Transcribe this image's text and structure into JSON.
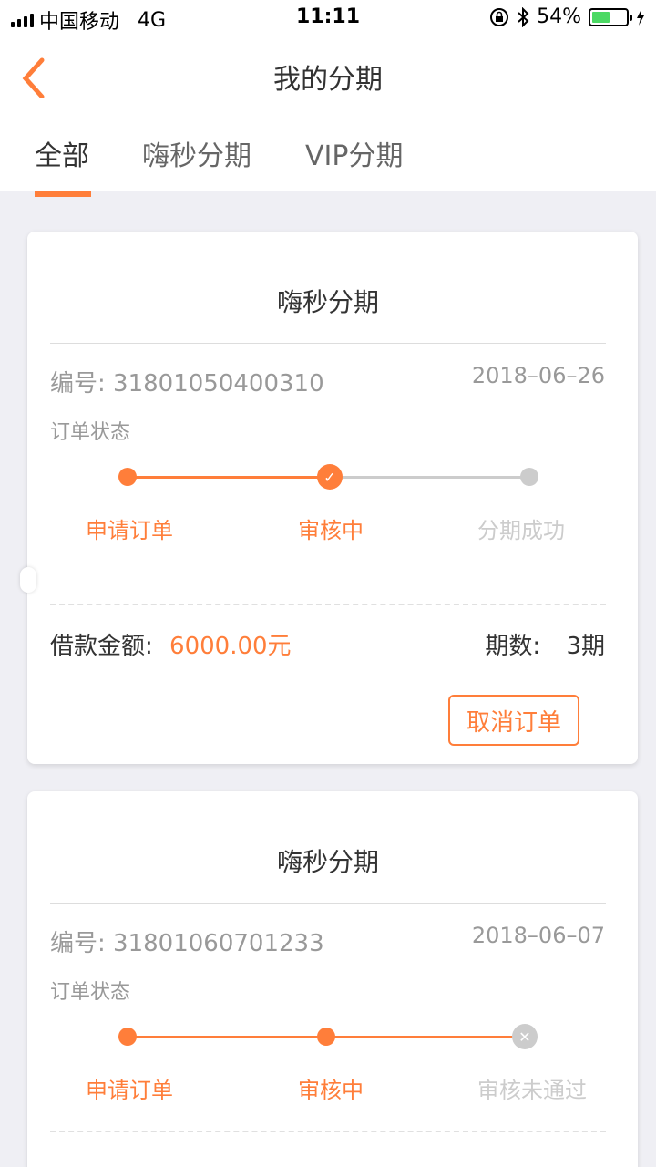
{
  "status_bar": {
    "carrier": "中国移动",
    "network": "4G",
    "time": "11:11",
    "battery_percent": "54%",
    "battery_level": 0.54
  },
  "nav": {
    "title": "我的分期",
    "back_icon": "chevron-left-icon"
  },
  "tabs": [
    {
      "label": "全部",
      "active": true
    },
    {
      "label": "嗨秒分期",
      "active": false
    },
    {
      "label": "VIP分期",
      "active": false
    }
  ],
  "colors": {
    "accent": "#ff7e3a",
    "inactive": "#cccccc",
    "background": "#efeff4"
  },
  "orders": [
    {
      "title": "嗨秒分期",
      "order_no": "编号: 31801050400310",
      "date": "2018–06–26",
      "status_label": "订单状态",
      "steps": [
        "申请订单",
        "审核中",
        "分期成功"
      ],
      "amount_label": "借款金额:",
      "amount_value": "6000.00元",
      "periods_label": "期数:",
      "periods_value": "3期",
      "cancel_label": "取消订单"
    },
    {
      "title": "嗨秒分期",
      "order_no": "编号: 31801060701233",
      "date": "2018–06–07",
      "status_label": "订单状态",
      "steps": [
        "申请订单",
        "审核中",
        "审核未通过"
      ]
    }
  ]
}
